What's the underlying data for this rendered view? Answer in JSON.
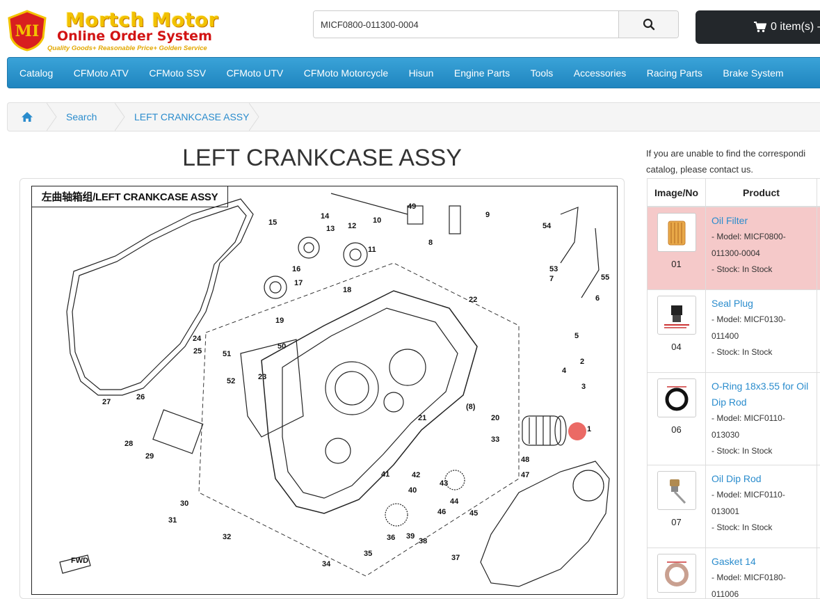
{
  "logo": {
    "badge": "MI",
    "title": "Mortch Motor",
    "subtitle": "Online Order System",
    "tagline": "Quality Goods+ Reasonable Price+ Golden Service"
  },
  "search": {
    "value": "MICF0800-011300-0004"
  },
  "cart": {
    "label": "0 item(s) -"
  },
  "nav": [
    "Catalog",
    "CFMoto ATV",
    "CFMoto SSV",
    "CFMoto UTV",
    "CFMoto Motorcycle",
    "Hisun",
    "Engine Parts",
    "Tools",
    "Accessories",
    "Racing Parts",
    "Brake System"
  ],
  "breadcrumb": {
    "search": "Search",
    "current": "LEFT CRANKCASE ASSY"
  },
  "page_title": "LEFT CRANKCASE ASSY",
  "diagram": {
    "label": "左曲轴箱组/LEFT CRANKCASE ASSY",
    "callouts": [
      "1",
      "2",
      "3",
      "4",
      "5",
      "6",
      "7",
      "8",
      "9",
      "10",
      "11",
      "12",
      "13",
      "14",
      "15",
      "16",
      "17",
      "18",
      "19",
      "20",
      "21",
      "22",
      "23",
      "24",
      "25",
      "26",
      "27",
      "28",
      "29",
      "30",
      "31",
      "32",
      "33",
      "34",
      "35",
      "36",
      "37",
      "38",
      "39",
      "40",
      "41",
      "42",
      "43",
      "44",
      "45",
      "46",
      "47",
      "48",
      "49",
      "50",
      "51",
      "52",
      "53",
      "54",
      "55",
      "(8)",
      "FWD"
    ]
  },
  "side_note": "If you are unable to find the correspondi... catalog, please contact us.",
  "side_note_lines": [
    "If you are unable to find the correspondi",
    "catalog, please contact us."
  ],
  "table": {
    "headers": [
      "Image/No",
      "Product"
    ],
    "rows": [
      {
        "no": "01",
        "name": "Oil Filter",
        "model_line1": "- Model: MICF0800-",
        "model_line2": "011300-0004",
        "stock": "- Stock:  In Stock"
      },
      {
        "no": "04",
        "name": "Seal Plug",
        "model_line1": "- Model: MICF0130-",
        "model_line2": "011400",
        "stock": "- Stock:  In Stock"
      },
      {
        "no": "06",
        "name": "O-Ring 18x3.55 for Oil",
        "name2": "Dip Rod",
        "model_line1": "- Model: MICF0110-",
        "model_line2": "013030",
        "stock": "- Stock:  In Stock"
      },
      {
        "no": "07",
        "name": "Oil Dip Rod",
        "model_line1": "- Model: MICF0110-",
        "model_line2": "013001",
        "stock": "- Stock:  In Stock"
      },
      {
        "no": "",
        "name": "Gasket 14",
        "model_line1": "- Model: MICF0180-",
        "model_line2": "011006",
        "stock": ""
      }
    ]
  },
  "colors": {
    "nav": "#2a93cc",
    "link": "#2a8ccd",
    "selected_row": "#f5c9c9",
    "highlight": "#e8504a"
  }
}
